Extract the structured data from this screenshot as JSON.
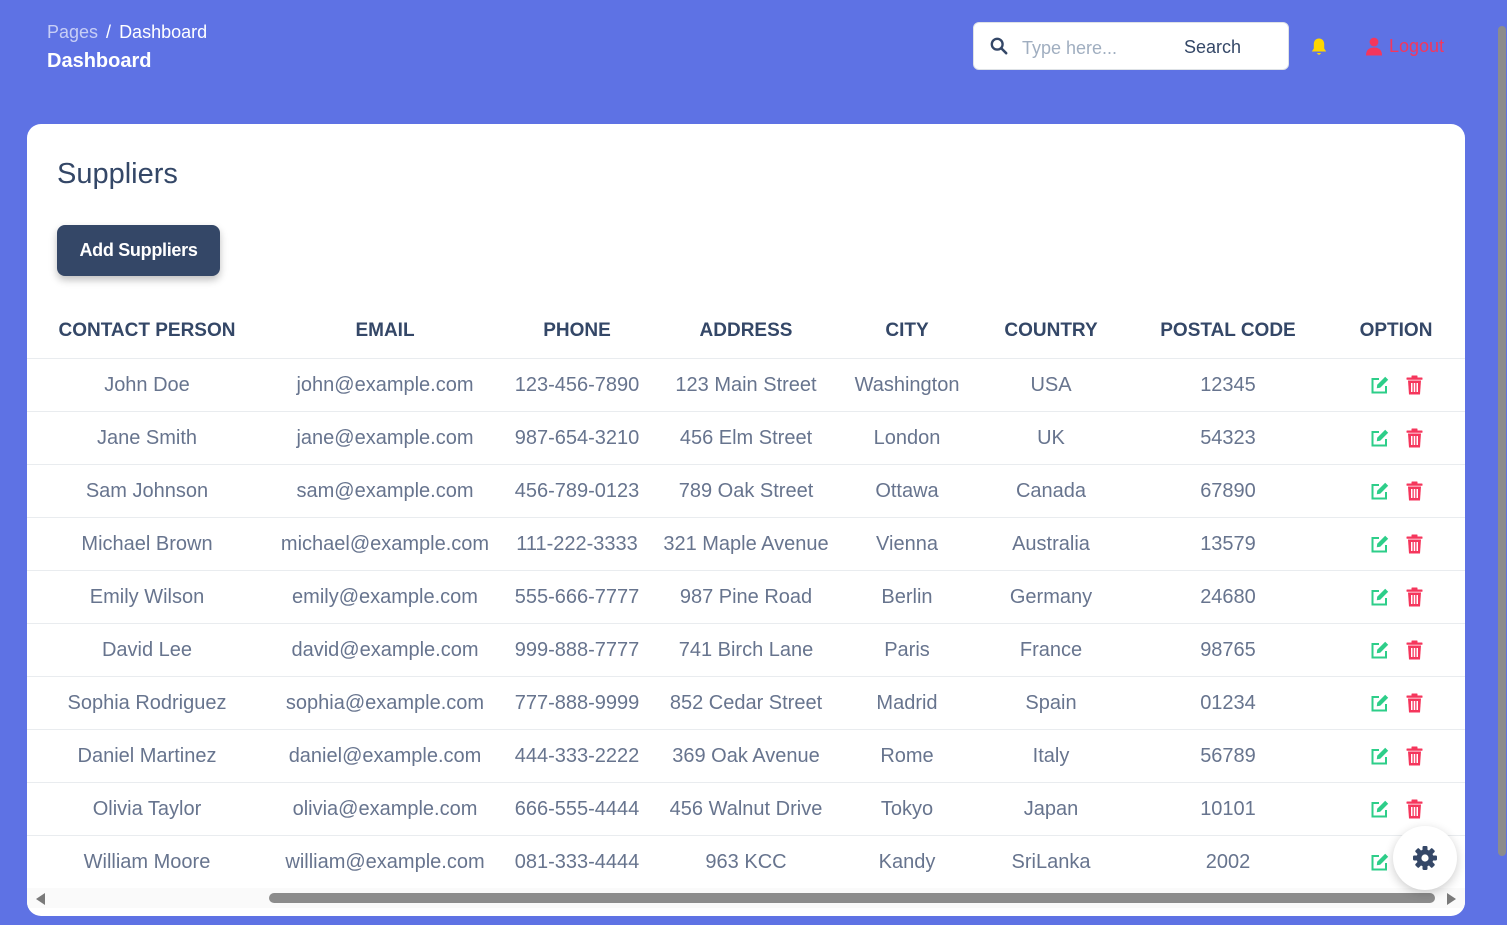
{
  "header": {
    "breadcrumb_root": "Pages",
    "breadcrumb_separator": "/",
    "breadcrumb_current": "Dashboard",
    "title": "Dashboard",
    "search_placeholder": "Type here...",
    "search_label": "Search",
    "logout_label": "Logout"
  },
  "card": {
    "title": "Suppliers",
    "add_button_label": "Add Suppliers"
  },
  "table": {
    "columns": [
      "CONTACT PERSON",
      "EMAIL",
      "PHONE",
      "ADDRESS",
      "CITY",
      "COUNTRY",
      "POSTAL CODE",
      "OPTION"
    ],
    "rows": [
      {
        "contact": "John Doe",
        "email": "john@example.com",
        "phone": "123-456-7890",
        "address": "123 Main Street",
        "city": "Washington",
        "country": "USA",
        "postal": "12345"
      },
      {
        "contact": "Jane Smith",
        "email": "jane@example.com",
        "phone": "987-654-3210",
        "address": "456 Elm Street",
        "city": "London",
        "country": "UK",
        "postal": "54323"
      },
      {
        "contact": "Sam Johnson",
        "email": "sam@example.com",
        "phone": "456-789-0123",
        "address": "789 Oak Street",
        "city": "Ottawa",
        "country": "Canada",
        "postal": "67890"
      },
      {
        "contact": "Michael Brown",
        "email": "michael@example.com",
        "phone": "111-222-3333",
        "address": "321 Maple Avenue",
        "city": "Vienna",
        "country": "Australia",
        "postal": "13579"
      },
      {
        "contact": "Emily Wilson",
        "email": "emily@example.com",
        "phone": "555-666-7777",
        "address": "987 Pine Road",
        "city": "Berlin",
        "country": "Germany",
        "postal": "24680"
      },
      {
        "contact": "David Lee",
        "email": "david@example.com",
        "phone": "999-888-7777",
        "address": "741 Birch Lane",
        "city": "Paris",
        "country": "France",
        "postal": "98765"
      },
      {
        "contact": "Sophia Rodriguez",
        "email": "sophia@example.com",
        "phone": "777-888-9999",
        "address": "852 Cedar Street",
        "city": "Madrid",
        "country": "Spain",
        "postal": "01234"
      },
      {
        "contact": "Daniel Martinez",
        "email": "daniel@example.com",
        "phone": "444-333-2222",
        "address": "369 Oak Avenue",
        "city": "Rome",
        "country": "Italy",
        "postal": "56789"
      },
      {
        "contact": "Olivia Taylor",
        "email": "olivia@example.com",
        "phone": "666-555-4444",
        "address": "456 Walnut Drive",
        "city": "Tokyo",
        "country": "Japan",
        "postal": "10101"
      },
      {
        "contact": "William Moore",
        "email": "william@example.com",
        "phone": "081-333-4444",
        "address": "963 KCC",
        "city": "Kandy",
        "country": "SriLanka",
        "postal": "2002"
      }
    ]
  },
  "icons": {
    "search": "search-icon",
    "bell": "bell-icon",
    "user": "user-icon",
    "edit": "edit-icon",
    "delete": "trash-icon",
    "settings": "gear-icon"
  },
  "colors": {
    "background": "#5e72e4",
    "primary_dark": "#344767",
    "edit": "#2dce89",
    "delete": "#f5365c",
    "bell": "#ffd600",
    "logout": "#f5365c"
  }
}
